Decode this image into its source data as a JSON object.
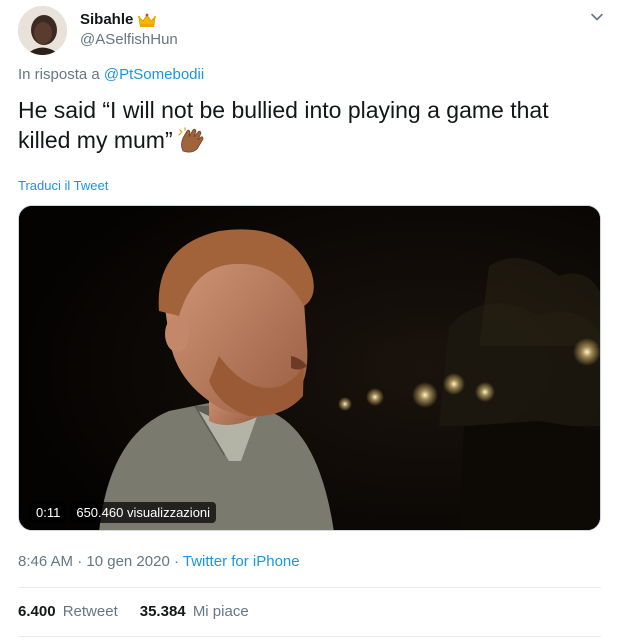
{
  "author": {
    "display_name": "Sibahle",
    "handle": "@ASelfishHun"
  },
  "reply": {
    "prefix": "In risposta a",
    "mention": "@PtSomebodii"
  },
  "tweet": {
    "text": "He said “I will not be bullied into playing a game that killed my mum”"
  },
  "translate_label": "Traduci il Tweet",
  "video": {
    "duration": "0:11",
    "views": "650.460 visualizzazioni"
  },
  "meta": {
    "time": "8:46 AM",
    "separator": "·",
    "date": "10 gen 2020",
    "source": "Twitter for iPhone"
  },
  "stats": {
    "retweets_count": "6.400",
    "retweets_label": "Retweet",
    "likes_count": "35.384",
    "likes_label": "Mi piace"
  },
  "icons": {
    "crown": "crown-emoji-icon",
    "clap": "clapping-hands-emoji-icon",
    "caret": "chevron-down-icon"
  },
  "colors": {
    "link": "#1b95e0",
    "secondary_text": "#657786",
    "primary_text": "#14171a"
  }
}
